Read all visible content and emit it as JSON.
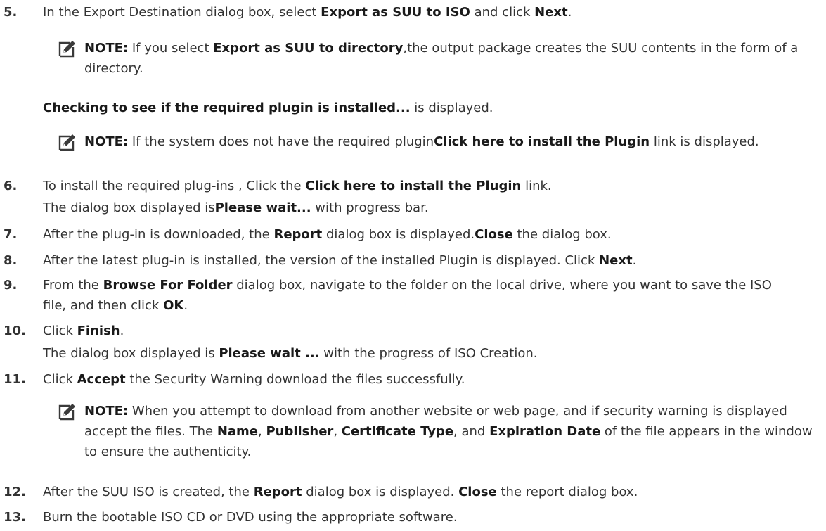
{
  "note_label": "NOTE:",
  "steps": {
    "s5": {
      "num": "5.",
      "t1": "In the Export Destination dialog box, select ",
      "b1": "Export as SUU to ISO",
      "t2": " and click ",
      "b2": "Next",
      "t3": "."
    },
    "note1": {
      "t1": " If you select ",
      "b1": "Export as SUU to directory",
      "t2": ",the output package creates the SUU contents in the form of a directory."
    },
    "para1": {
      "b1": "Checking to see if the required plugin is installed...",
      "t1": " is displayed."
    },
    "note2": {
      "t1": " If the system does not have the required plugin",
      "b1": "Click here to install the Plugin",
      "t2": " link is displayed."
    },
    "s6": {
      "num": "6.",
      "t1": "To install the required plug-ins , Click the ",
      "b1": "Click here to install the Plugin",
      "t2": " link."
    },
    "para2": {
      "t1": "The dialog box displayed is",
      "b1": "Please wait...",
      "t2": " with progress bar."
    },
    "s7": {
      "num": "7.",
      "t1": "After the plug-in is downloaded, the ",
      "b1": "Report",
      "t2": " dialog box is displayed.",
      "b2": "Close",
      "t3": " the dialog box."
    },
    "s8": {
      "num": "8.",
      "t1": "After the latest plug-in is installed, the version of the installed Plugin is displayed. Click ",
      "b1": "Next",
      "t2": "."
    },
    "s9": {
      "num": "9.",
      "t1": "From the ",
      "b1": "Browse For Folder",
      "t2": " dialog box, navigate to the folder on the local drive, where you want to save the ISO file, and then click ",
      "b2": "OK",
      "t3": "."
    },
    "s10": {
      "num": "10.",
      "t1": "Click ",
      "b1": "Finish",
      "t2": "."
    },
    "para3": {
      "t1": "The dialog box displayed is ",
      "b1": "Please wait ...",
      "t2": " with the progress of ISO Creation."
    },
    "s11": {
      "num": "11.",
      "t1": "Click ",
      "b1": "Accept",
      "t2": " the Security Warning download the files successfully."
    },
    "note3": {
      "t1": " When you attempt to download from another website or web page, and if security warning is displayed accept the files. The ",
      "b1": "Name",
      "t2": ", ",
      "b2": "Publisher",
      "t3": ", ",
      "b3": "Certificate Type",
      "t4": ", and ",
      "b4": "Expiration Date",
      "t5": " of the file appears in the window to ensure the authenticity."
    },
    "s12": {
      "num": "12.",
      "t1": "After the SUU ISO is created, the ",
      "b1": "Report",
      "t2": " dialog box is displayed. ",
      "b2": "Close",
      "t3": " the report dialog box."
    },
    "s13": {
      "num": "13.",
      "t1": "Burn the bootable ISO CD or DVD using the appropriate software."
    }
  }
}
